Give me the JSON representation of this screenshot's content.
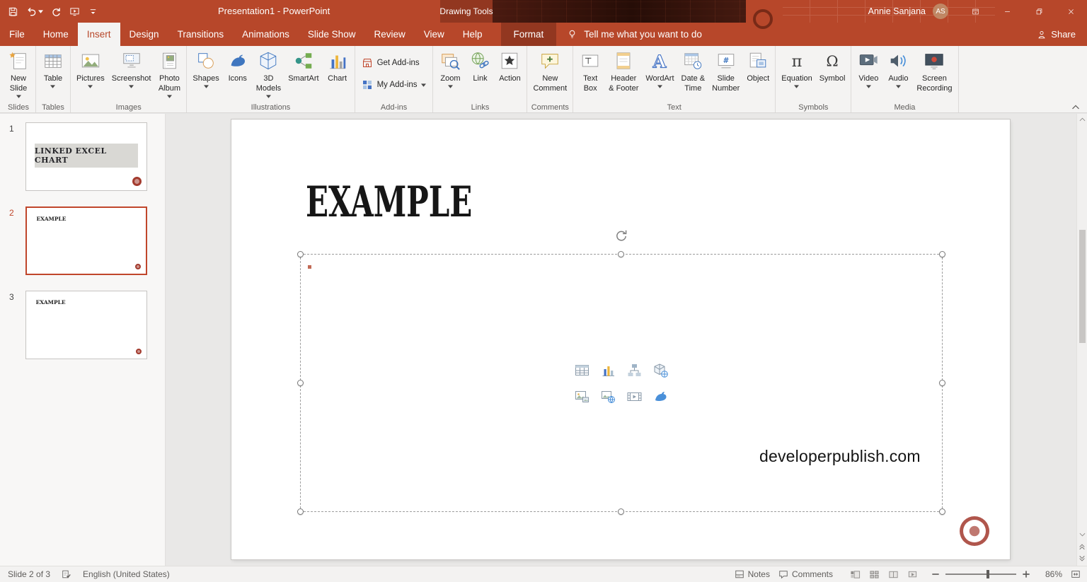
{
  "window": {
    "title": "Presentation1 - PowerPoint",
    "contextual_tools": "Drawing Tools",
    "user": {
      "name": "Annie Sanjana",
      "initials": "AS"
    }
  },
  "quick_access": {
    "buttons": [
      {
        "name": "save",
        "icon": "save-icon"
      },
      {
        "name": "undo",
        "icon": "undo-icon",
        "dropdown": true
      },
      {
        "name": "redo",
        "icon": "redo-icon"
      },
      {
        "name": "start-slideshow",
        "icon": "start-slideshow-icon"
      },
      {
        "name": "customize-quick-access",
        "icon": "qat-caret-icon"
      }
    ]
  },
  "window_controls": [
    {
      "name": "ribbon-display-options",
      "icon": "ribbon-display-icon"
    },
    {
      "name": "minimize",
      "icon": "minimize-icon"
    },
    {
      "name": "restore",
      "icon": "restore-icon"
    },
    {
      "name": "close",
      "icon": "close-icon"
    }
  ],
  "tabs": {
    "items": [
      {
        "label": "File",
        "name": "file"
      },
      {
        "label": "Home",
        "name": "home"
      },
      {
        "label": "Insert",
        "name": "insert",
        "active": true
      },
      {
        "label": "Design",
        "name": "design"
      },
      {
        "label": "Transitions",
        "name": "transitions"
      },
      {
        "label": "Animations",
        "name": "animations"
      },
      {
        "label": "Slide Show",
        "name": "slide-show"
      },
      {
        "label": "Review",
        "name": "review"
      },
      {
        "label": "View",
        "name": "view"
      },
      {
        "label": "Help",
        "name": "help"
      }
    ],
    "contextual": {
      "label": "Format",
      "name": "format"
    },
    "tell_me": "Tell me what you want to do",
    "share": "Share"
  },
  "ribbon": {
    "groups": [
      {
        "label": "Slides",
        "buttons": [
          {
            "name": "new-slide",
            "label": "New Slide",
            "lines": [
              "New",
              "Slide"
            ],
            "icon": "new-slide-icon",
            "dropdown": true
          }
        ]
      },
      {
        "label": "Tables",
        "buttons": [
          {
            "name": "table",
            "label": "Table",
            "lines": [
              "Table"
            ],
            "icon": "table-icon",
            "dropdown": true
          }
        ]
      },
      {
        "label": "Images",
        "buttons": [
          {
            "name": "pictures",
            "label": "Pictures",
            "lines": [
              "Pictures"
            ],
            "icon": "pictures-icon",
            "dropdown": true
          },
          {
            "name": "screenshot",
            "label": "Screenshot",
            "lines": [
              "Screenshot"
            ],
            "icon": "screenshot-icon",
            "dropdown": true
          },
          {
            "name": "photo-album",
            "label": "Photo Album",
            "lines": [
              "Photo",
              "Album"
            ],
            "icon": "photo-album-icon",
            "dropdown": true
          }
        ]
      },
      {
        "label": "Illustrations",
        "buttons": [
          {
            "name": "shapes",
            "label": "Shapes",
            "lines": [
              "Shapes"
            ],
            "icon": "shapes-icon",
            "dropdown": true
          },
          {
            "name": "icons",
            "label": "Icons",
            "lines": [
              "Icons"
            ],
            "icon": "icons-icon"
          },
          {
            "name": "3d-models",
            "label": "3D Models",
            "lines": [
              "3D",
              "Models"
            ],
            "icon": "3d-models-icon",
            "dropdown": true
          },
          {
            "name": "smartart",
            "label": "SmartArt",
            "lines": [
              "SmartArt"
            ],
            "icon": "smartart-icon"
          },
          {
            "name": "chart",
            "label": "Chart",
            "lines": [
              "Chart"
            ],
            "icon": "chart-icon"
          }
        ]
      },
      {
        "label": "Add-ins",
        "small": true,
        "buttons": [
          {
            "name": "get-add-ins",
            "label": "Get Add-ins",
            "icon": "store-icon"
          },
          {
            "name": "my-add-ins",
            "label": "My Add-ins",
            "icon": "my-add-ins-icon",
            "dropdown": true
          }
        ]
      },
      {
        "label": "Links",
        "buttons": [
          {
            "name": "zoom",
            "label": "Zoom",
            "lines": [
              "Zoom"
            ],
            "icon": "zoom-icon",
            "dropdown": true
          },
          {
            "name": "link",
            "label": "Link",
            "lines": [
              "Link"
            ],
            "icon": "link-icon"
          },
          {
            "name": "action",
            "label": "Action",
            "lines": [
              "Action"
            ],
            "icon": "action-icon"
          }
        ]
      },
      {
        "label": "Comments",
        "buttons": [
          {
            "name": "new-comment",
            "label": "New Comment",
            "lines": [
              "New",
              "Comment"
            ],
            "icon": "new-comment-icon"
          }
        ]
      },
      {
        "label": "Text",
        "buttons": [
          {
            "name": "text-box",
            "label": "Text Box",
            "lines": [
              "Text",
              "Box"
            ],
            "icon": "text-box-icon"
          },
          {
            "name": "header-footer",
            "label": "Header & Footer",
            "lines": [
              "Header",
              "& Footer"
            ],
            "icon": "header-footer-icon"
          },
          {
            "name": "wordart",
            "label": "WordArt",
            "lines": [
              "WordArt"
            ],
            "icon": "wordart-icon",
            "dropdown": true
          },
          {
            "name": "date-time",
            "label": "Date & Time",
            "lines": [
              "Date &",
              "Time"
            ],
            "icon": "date-time-icon"
          },
          {
            "name": "slide-number",
            "label": "Slide Number",
            "lines": [
              "Slide",
              "Number"
            ],
            "icon": "slide-number-icon"
          },
          {
            "name": "object",
            "label": "Object",
            "lines": [
              "Object"
            ],
            "icon": "object-icon"
          }
        ]
      },
      {
        "label": "Symbols",
        "buttons": [
          {
            "name": "equation",
            "label": "Equation",
            "lines": [
              "Equation"
            ],
            "icon": "equation-icon",
            "dropdown": true
          },
          {
            "name": "symbol",
            "label": "Symbol",
            "lines": [
              "Symbol"
            ],
            "icon": "symbol-icon"
          }
        ]
      },
      {
        "label": "Media",
        "buttons": [
          {
            "name": "video",
            "label": "Video",
            "lines": [
              "Video"
            ],
            "icon": "video-icon",
            "dropdown": true
          },
          {
            "name": "audio",
            "label": "Audio",
            "lines": [
              "Audio"
            ],
            "icon": "audio-icon",
            "dropdown": true
          },
          {
            "name": "screen-recording",
            "label": "Screen Recording",
            "lines": [
              "Screen",
              "Recording"
            ],
            "icon": "screen-recording-icon"
          }
        ]
      }
    ]
  },
  "slides_panel": {
    "slides": [
      {
        "number": "1",
        "text": "LINKED EXCEL CHART",
        "style": "label"
      },
      {
        "number": "2",
        "text": "EXAMPLE",
        "selected": true
      },
      {
        "number": "3",
        "text": "EXAMPLE"
      }
    ]
  },
  "slide": {
    "title": "EXAMPLE",
    "watermark": "developerpublish.com",
    "placeholder_icons": [
      "insert-table-icon",
      "insert-chart-icon",
      "insert-smartart-icon",
      "insert-3d-model-icon",
      "insert-picture-icon",
      "insert-online-picture-icon",
      "insert-video-icon",
      "insert-icons-icon"
    ]
  },
  "status_bar": {
    "slide_indicator": "Slide 2 of 3",
    "language": "English (United States)",
    "notes": "Notes",
    "comments": "Comments",
    "zoom": "86%",
    "views": [
      {
        "name": "normal-view",
        "icon": "view-normal-icon"
      },
      {
        "name": "slide-sorter-view",
        "icon": "view-sorter-icon"
      },
      {
        "name": "reading-view",
        "icon": "view-reading-icon"
      },
      {
        "name": "slideshow-view",
        "icon": "view-slideshow-icon"
      }
    ]
  },
  "colors": {
    "accent": "#B7472A",
    "selection_red": "#C0462B",
    "stamp_red": "#A33B2E",
    "ribbon_bg": "#F4F3F2"
  }
}
